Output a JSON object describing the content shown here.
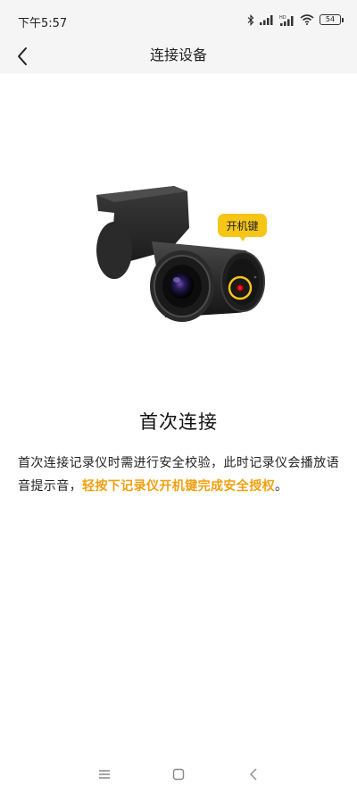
{
  "status_bar": {
    "time": "下午5:57",
    "battery_level": "54",
    "icons": [
      "bluetooth-icon",
      "signal-icon",
      "hd-signal-icon",
      "wifi-icon",
      "battery-icon"
    ]
  },
  "nav": {
    "title": "连接设备",
    "back_icon": "chevron-left-icon"
  },
  "illustration": {
    "power_key_label": "开机键",
    "accent_color": "#f5c518"
  },
  "content": {
    "title": "首次连接",
    "description_normal": "首次连接记录仪时需进行安全校验，此时记录仪会播放语音提示音，",
    "description_highlight": "轻按下记录仪开机键完成安全授权",
    "description_end": "。",
    "highlight_color": "#f0a010"
  },
  "system_nav": {
    "icons": [
      "menu-icon",
      "home-icon",
      "back-icon"
    ]
  }
}
